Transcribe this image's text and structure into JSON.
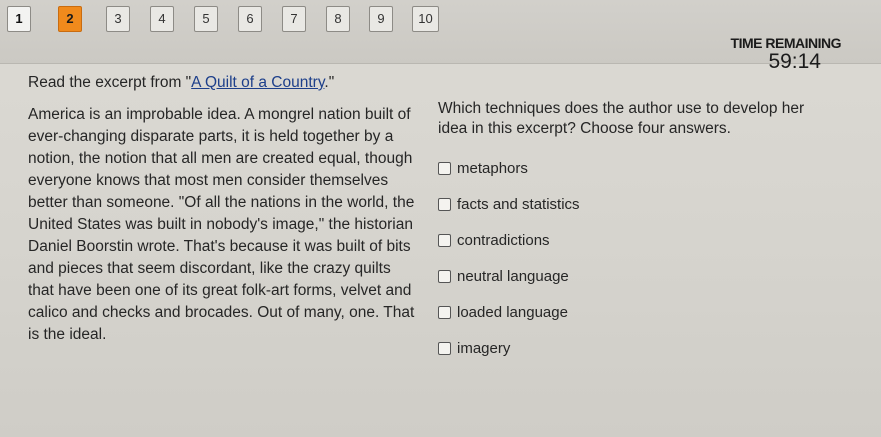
{
  "nav": {
    "questions": [
      {
        "label": "1",
        "state": "done"
      },
      {
        "label": "2",
        "state": "current"
      },
      {
        "label": "3",
        "state": "unanswered"
      },
      {
        "label": "4",
        "state": "unanswered"
      },
      {
        "label": "5",
        "state": "unanswered"
      },
      {
        "label": "6",
        "state": "unanswered"
      },
      {
        "label": "7",
        "state": "unanswered"
      },
      {
        "label": "8",
        "state": "unanswered"
      },
      {
        "label": "9",
        "state": "unanswered"
      },
      {
        "label": "10",
        "state": "unanswered"
      }
    ],
    "current_color": "#f08a1c"
  },
  "timer": {
    "label": "TIME REMAINING",
    "value": "59:14"
  },
  "passage": {
    "intro_before": "Read the excerpt from \"",
    "title_link": "A Quilt of a Country",
    "intro_after": ".\"",
    "text": "America is an improbable idea. A mongrel nation built of ever-changing disparate parts, it is held together by a notion, the notion that all men are created equal, though everyone knows that most men consider themselves better than someone. \"Of all the nations in the world, the United States was built in nobody's image,\" the historian Daniel Boorstin wrote. That's because it was built of bits and pieces that seem discordant, like the crazy quilts that have been one of its great folk-art forms, velvet and calico and checks and brocades. Out of many, one. That is the ideal."
  },
  "question": {
    "prompt": "Which techniques does the author use to develop her idea in this excerpt? Choose four answers.",
    "options": [
      {
        "label": "metaphors",
        "checked": false
      },
      {
        "label": "facts and statistics",
        "checked": false
      },
      {
        "label": "contradictions",
        "checked": false
      },
      {
        "label": "neutral language",
        "checked": false
      },
      {
        "label": "loaded language",
        "checked": false
      },
      {
        "label": "imagery",
        "checked": false
      }
    ]
  }
}
